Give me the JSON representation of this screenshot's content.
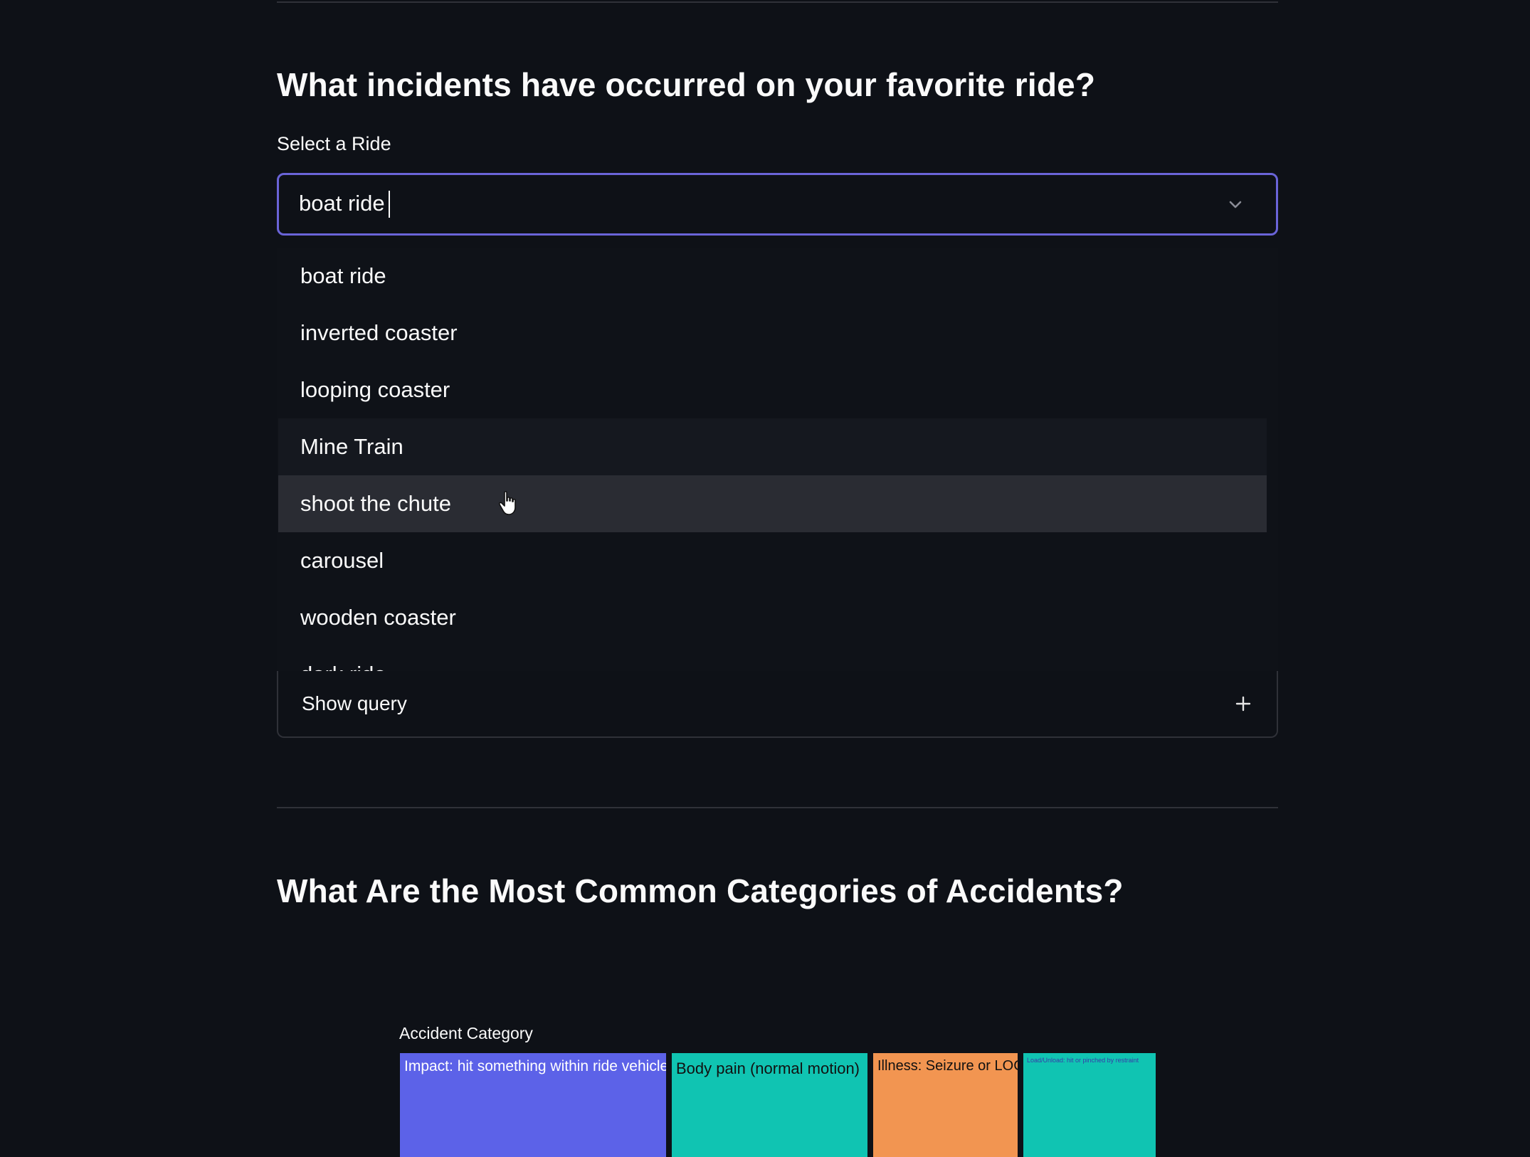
{
  "sections": {
    "incidents": {
      "heading": "What incidents have occurred on your favorite ride?",
      "select_label": "Select a Ride",
      "select_value": "boat ride",
      "options": [
        "boat ride",
        "inverted coaster",
        "looping coaster",
        "Mine Train",
        "shoot the chute",
        "carousel",
        "wooden coaster",
        "dark ride"
      ],
      "hovered_option": "shoot the chute",
      "expander_label": "Show query"
    },
    "categories": {
      "heading": "What Are the Most Common Categories of Accidents?"
    }
  },
  "chart_data": {
    "type": "treemap",
    "title": "Accident Category",
    "categories": [
      {
        "label": "Impact: hit something within ride vehicle",
        "color": "#5c62e8"
      },
      {
        "label": "Body pain (normal motion)",
        "color": "#10c4b2"
      },
      {
        "label": "Illness: Seizure or LOC",
        "color": "#f29551"
      },
      {
        "label": "Load/Unload: hit or pinched by restraint",
        "color": "#10c4b2"
      }
    ]
  },
  "colors": {
    "background": "#0e1117",
    "accent": "#6a64d8",
    "text": "#fafafa"
  },
  "icons": {
    "select_chevron": "chevron-down-icon",
    "expander": "plus-icon",
    "cursor": "hand-pointer-icon"
  }
}
